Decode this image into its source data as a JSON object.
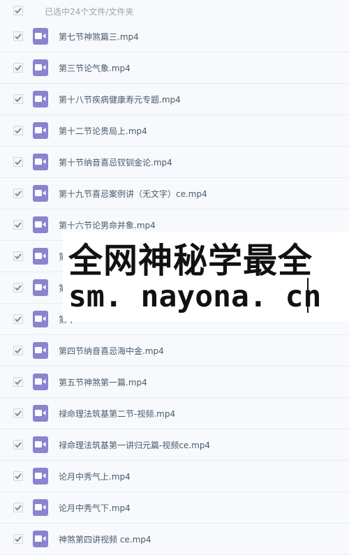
{
  "header": {
    "selected_text": "已选中24个文件/文件夹"
  },
  "files": [
    "第七节神煞篇三.mp4",
    "第三节论气象.mp4",
    "第十八节疾病健康寿元专题.mp4",
    "第十二节论贵局上.mp4",
    "第十节纳音喜忌钗钏金论.mp4",
    "第十九节喜忌案例讲（无文字）ce.mp4",
    "第十六节论男命并象.mp4",
    "第",
    "第",
    "第十",
    "第四节纳音喜忌海中金.mp4",
    "第五节神煞第一篇.mp4",
    "禄命理法筑基第二节-视频.mp4",
    "禄命理法筑基第一讲归元篇-视频ce.mp4",
    "论月中秀气上.mp4",
    "论月中秀气下.mp4",
    "神煞第四讲视频 ce.mp4"
  ],
  "watermark": {
    "line1": "全网神秘学最全",
    "line2": "sm. nayona. cn"
  },
  "colors": {
    "checkmark": "#7b8a99",
    "icon_bg": "#8b83cf",
    "row_bg": "#f7f9fc"
  }
}
